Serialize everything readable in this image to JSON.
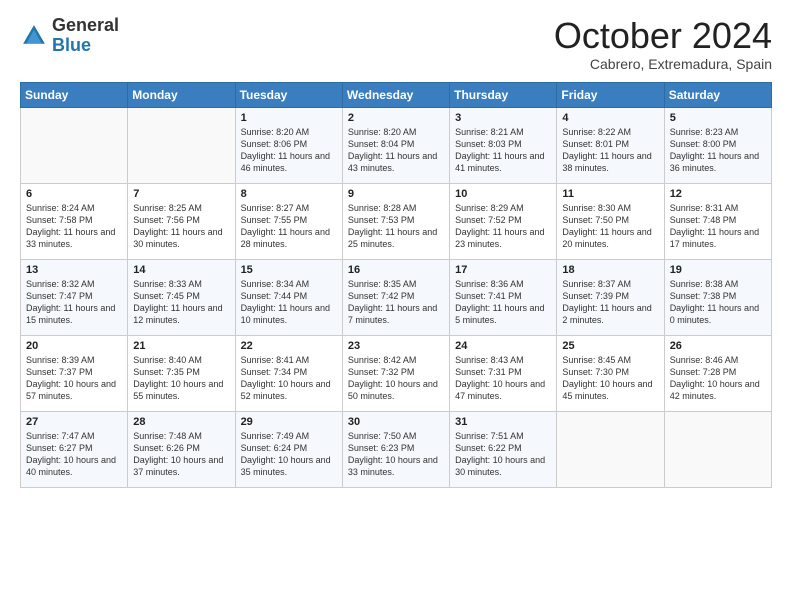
{
  "header": {
    "logo_general": "General",
    "logo_blue": "Blue",
    "month": "October 2024",
    "location": "Cabrero, Extremadura, Spain"
  },
  "days_of_week": [
    "Sunday",
    "Monday",
    "Tuesday",
    "Wednesday",
    "Thursday",
    "Friday",
    "Saturday"
  ],
  "weeks": [
    [
      {
        "day": "",
        "text": ""
      },
      {
        "day": "",
        "text": ""
      },
      {
        "day": "1",
        "text": "Sunrise: 8:20 AM\nSunset: 8:06 PM\nDaylight: 11 hours and 46 minutes."
      },
      {
        "day": "2",
        "text": "Sunrise: 8:20 AM\nSunset: 8:04 PM\nDaylight: 11 hours and 43 minutes."
      },
      {
        "day": "3",
        "text": "Sunrise: 8:21 AM\nSunset: 8:03 PM\nDaylight: 11 hours and 41 minutes."
      },
      {
        "day": "4",
        "text": "Sunrise: 8:22 AM\nSunset: 8:01 PM\nDaylight: 11 hours and 38 minutes."
      },
      {
        "day": "5",
        "text": "Sunrise: 8:23 AM\nSunset: 8:00 PM\nDaylight: 11 hours and 36 minutes."
      }
    ],
    [
      {
        "day": "6",
        "text": "Sunrise: 8:24 AM\nSunset: 7:58 PM\nDaylight: 11 hours and 33 minutes."
      },
      {
        "day": "7",
        "text": "Sunrise: 8:25 AM\nSunset: 7:56 PM\nDaylight: 11 hours and 30 minutes."
      },
      {
        "day": "8",
        "text": "Sunrise: 8:27 AM\nSunset: 7:55 PM\nDaylight: 11 hours and 28 minutes."
      },
      {
        "day": "9",
        "text": "Sunrise: 8:28 AM\nSunset: 7:53 PM\nDaylight: 11 hours and 25 minutes."
      },
      {
        "day": "10",
        "text": "Sunrise: 8:29 AM\nSunset: 7:52 PM\nDaylight: 11 hours and 23 minutes."
      },
      {
        "day": "11",
        "text": "Sunrise: 8:30 AM\nSunset: 7:50 PM\nDaylight: 11 hours and 20 minutes."
      },
      {
        "day": "12",
        "text": "Sunrise: 8:31 AM\nSunset: 7:48 PM\nDaylight: 11 hours and 17 minutes."
      }
    ],
    [
      {
        "day": "13",
        "text": "Sunrise: 8:32 AM\nSunset: 7:47 PM\nDaylight: 11 hours and 15 minutes."
      },
      {
        "day": "14",
        "text": "Sunrise: 8:33 AM\nSunset: 7:45 PM\nDaylight: 11 hours and 12 minutes."
      },
      {
        "day": "15",
        "text": "Sunrise: 8:34 AM\nSunset: 7:44 PM\nDaylight: 11 hours and 10 minutes."
      },
      {
        "day": "16",
        "text": "Sunrise: 8:35 AM\nSunset: 7:42 PM\nDaylight: 11 hours and 7 minutes."
      },
      {
        "day": "17",
        "text": "Sunrise: 8:36 AM\nSunset: 7:41 PM\nDaylight: 11 hours and 5 minutes."
      },
      {
        "day": "18",
        "text": "Sunrise: 8:37 AM\nSunset: 7:39 PM\nDaylight: 11 hours and 2 minutes."
      },
      {
        "day": "19",
        "text": "Sunrise: 8:38 AM\nSunset: 7:38 PM\nDaylight: 11 hours and 0 minutes."
      }
    ],
    [
      {
        "day": "20",
        "text": "Sunrise: 8:39 AM\nSunset: 7:37 PM\nDaylight: 10 hours and 57 minutes."
      },
      {
        "day": "21",
        "text": "Sunrise: 8:40 AM\nSunset: 7:35 PM\nDaylight: 10 hours and 55 minutes."
      },
      {
        "day": "22",
        "text": "Sunrise: 8:41 AM\nSunset: 7:34 PM\nDaylight: 10 hours and 52 minutes."
      },
      {
        "day": "23",
        "text": "Sunrise: 8:42 AM\nSunset: 7:32 PM\nDaylight: 10 hours and 50 minutes."
      },
      {
        "day": "24",
        "text": "Sunrise: 8:43 AM\nSunset: 7:31 PM\nDaylight: 10 hours and 47 minutes."
      },
      {
        "day": "25",
        "text": "Sunrise: 8:45 AM\nSunset: 7:30 PM\nDaylight: 10 hours and 45 minutes."
      },
      {
        "day": "26",
        "text": "Sunrise: 8:46 AM\nSunset: 7:28 PM\nDaylight: 10 hours and 42 minutes."
      }
    ],
    [
      {
        "day": "27",
        "text": "Sunrise: 7:47 AM\nSunset: 6:27 PM\nDaylight: 10 hours and 40 minutes."
      },
      {
        "day": "28",
        "text": "Sunrise: 7:48 AM\nSunset: 6:26 PM\nDaylight: 10 hours and 37 minutes."
      },
      {
        "day": "29",
        "text": "Sunrise: 7:49 AM\nSunset: 6:24 PM\nDaylight: 10 hours and 35 minutes."
      },
      {
        "day": "30",
        "text": "Sunrise: 7:50 AM\nSunset: 6:23 PM\nDaylight: 10 hours and 33 minutes."
      },
      {
        "day": "31",
        "text": "Sunrise: 7:51 AM\nSunset: 6:22 PM\nDaylight: 10 hours and 30 minutes."
      },
      {
        "day": "",
        "text": ""
      },
      {
        "day": "",
        "text": ""
      }
    ]
  ]
}
